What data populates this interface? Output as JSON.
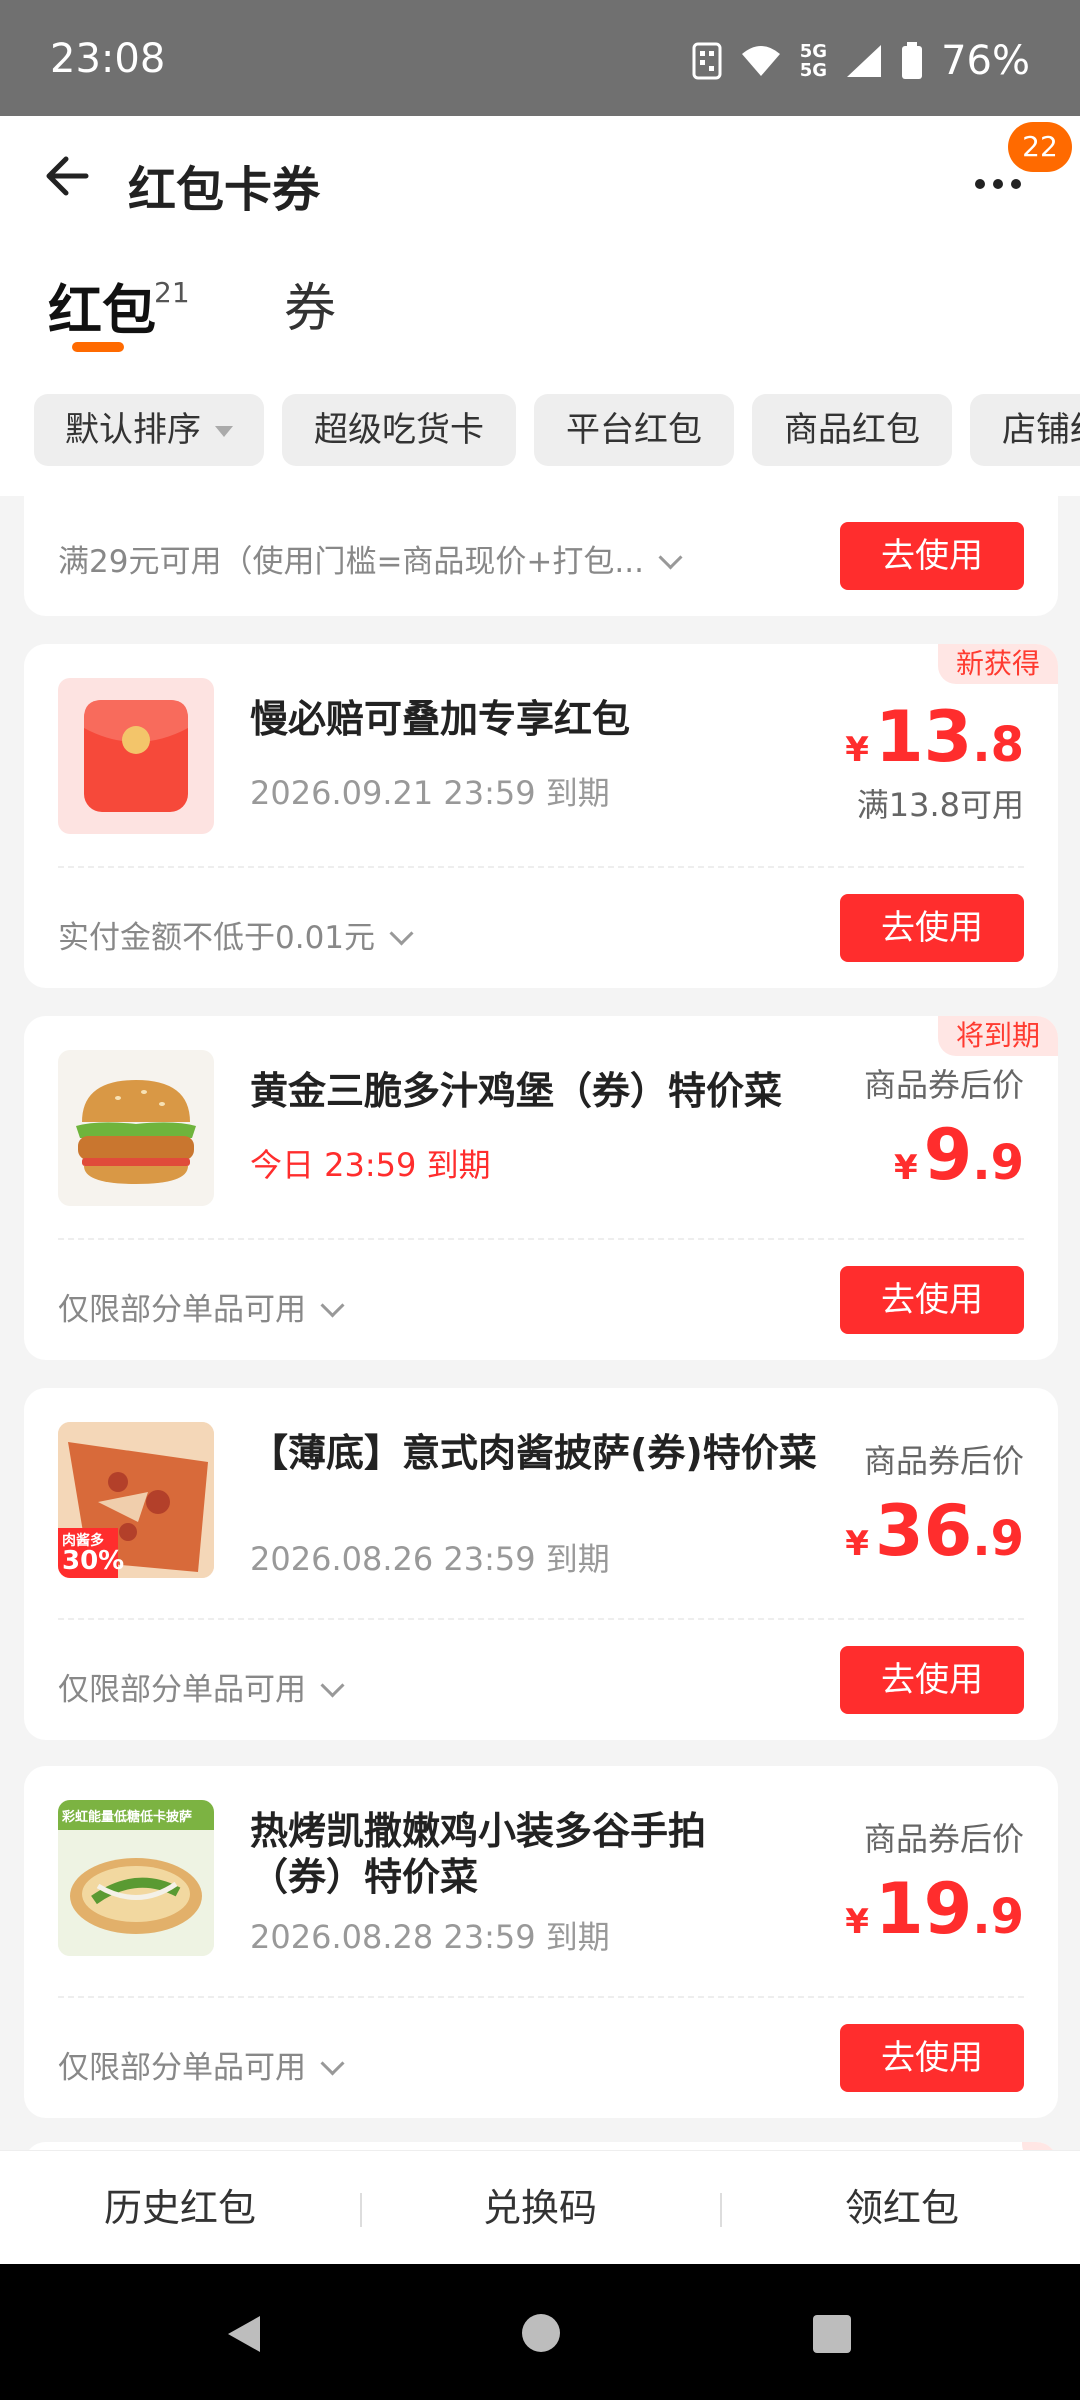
{
  "status": {
    "time": "23:08",
    "battery": "76%",
    "network": "5G"
  },
  "header": {
    "title": "红包卡券",
    "more_badge": "22"
  },
  "tabs": [
    {
      "label": "红包",
      "count": "21"
    },
    {
      "label": "券"
    }
  ],
  "filters": [
    "默认排序",
    "超级吃货卡",
    "平台红包",
    "商品红包",
    "店铺红包"
  ],
  "cards": [
    {
      "condition": "满29元可用（使用门槛=商品现价+打包...",
      "button": "去使用"
    },
    {
      "tag": "新获得",
      "title": "慢必赔可叠加专享红包",
      "expiry": "2026.09.21 23:59 到期",
      "price_int": "13",
      "price_dec": ".8",
      "currency": "¥",
      "price_note": "满13.8可用",
      "condition": "实付金额不低于0.01元",
      "button": "去使用"
    },
    {
      "tag": "将到期",
      "title": "黄金三脆多汁鸡堡（券）特价菜",
      "expiry": "今日 23:59 到期",
      "price_label": "商品券后价",
      "price_int": "9",
      "price_dec": ".9",
      "currency": "¥",
      "condition": "仅限部分单品可用",
      "button": "去使用"
    },
    {
      "title": "【薄底】意式肉酱披萨(券)特价菜",
      "expiry": "2026.08.26 23:59 到期",
      "price_label": "商品券后价",
      "price_int": "36",
      "price_dec": ".9",
      "currency": "¥",
      "condition": "仅限部分单品可用",
      "button": "去使用",
      "thumb_badge": "30%",
      "thumb_text": "肉酱多"
    },
    {
      "title": "热烤凯撒嫩鸡小装多谷手拍（券）特价菜",
      "expiry": "2026.08.28 23:59 到期",
      "price_label": "商品券后价",
      "price_int": "19",
      "price_dec": ".9",
      "currency": "¥",
      "condition": "仅限部分单品可用",
      "button": "去使用",
      "thumb_text": "彩虹能量低糖低卡披萨"
    }
  ],
  "bottom_bar": [
    "历史红包",
    "兑换码",
    "领红包"
  ],
  "colors": {
    "accent": "#ff6a00",
    "price_red": "#ff2d2d",
    "status_bar": "#707070"
  }
}
